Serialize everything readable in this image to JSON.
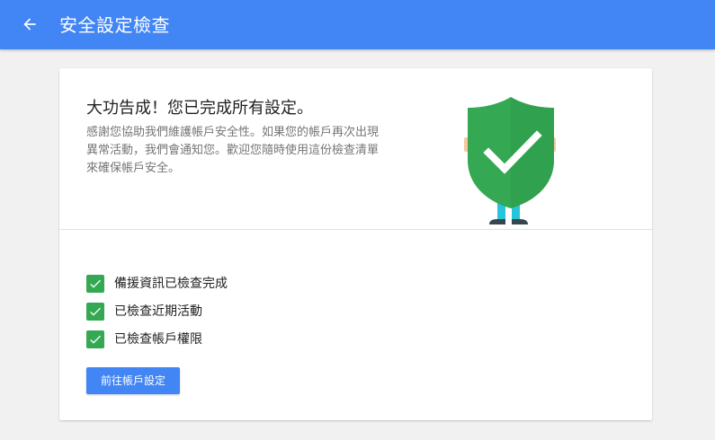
{
  "header": {
    "title": "安全設定檢查",
    "back_icon": "arrow-back-icon",
    "color": "#4285f4"
  },
  "hero": {
    "title": "大功告成！您已完成所有設定。",
    "description": "感謝您協助我們維護帳戶安全性。如果您的帳戶再次出現異常活動，我們會通知您。歡迎您隨時使用這份檢查清單來確保帳戶安全。",
    "illustration_icon": "shield-check-icon",
    "shield_color": "#34a853"
  },
  "checklist": {
    "items": [
      {
        "label": "備援資訊已檢查完成",
        "checked": true
      },
      {
        "label": "已檢查近期活動",
        "checked": true
      },
      {
        "label": "已檢查帳戶權限",
        "checked": true
      }
    ],
    "check_color": "#34a853"
  },
  "action": {
    "label": "前往帳戶設定"
  }
}
